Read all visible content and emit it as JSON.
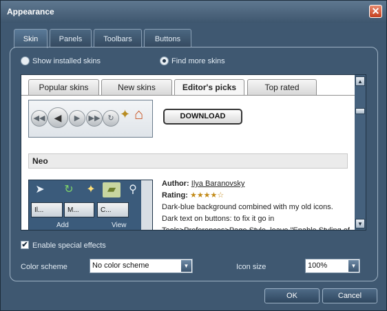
{
  "window": {
    "title": "Appearance",
    "close_glyph": "✕"
  },
  "tabs": [
    {
      "label": "Skin",
      "active": true
    },
    {
      "label": "Panels",
      "active": false
    },
    {
      "label": "Toolbars",
      "active": false
    },
    {
      "label": "Buttons",
      "active": false
    }
  ],
  "skin_source": {
    "options": [
      {
        "label": "Show installed skins",
        "selected": false
      },
      {
        "label": "Find more skins",
        "selected": true
      }
    ]
  },
  "browser": {
    "tabs": [
      {
        "label": "Popular skins",
        "active": false
      },
      {
        "label": "New skins",
        "active": false
      },
      {
        "label": "Editor's picks",
        "active": true
      },
      {
        "label": "Top rated",
        "active": false
      }
    ],
    "download_label": "DOWNLOAD",
    "skin": {
      "name": "Neo",
      "author_label": "Author:",
      "author": "Ilya Baranovsky",
      "rating_label": "Rating:",
      "rating_stars": 4,
      "rating_max": 5,
      "description": "Dark-blue background combined with my old icons. Dark text on buttons: to fix it go in Tools>Preferences>Page Style, leave \"Enable Styling of Forms\" UNCHECKED",
      "preview_tabs": [
        "Il...",
        "M...",
        "C..."
      ],
      "preview_toolbar": [
        "Add",
        "View"
      ]
    },
    "icons": [
      "back-icon",
      "forward-icon",
      "reload-icon",
      "wand-icon",
      "home-icon",
      "scroll-up-icon",
      "scroll-down-icon"
    ]
  },
  "special_effects": {
    "label": "Enable special effects",
    "checked": true
  },
  "color_scheme": {
    "label": "Color scheme",
    "value": "No color scheme"
  },
  "icon_size": {
    "label": "Icon size",
    "value": "100%"
  },
  "buttons": {
    "ok": "OK",
    "cancel": "Cancel"
  },
  "colors": {
    "window_bg": "#3f5871",
    "accent": "#c4401f"
  }
}
